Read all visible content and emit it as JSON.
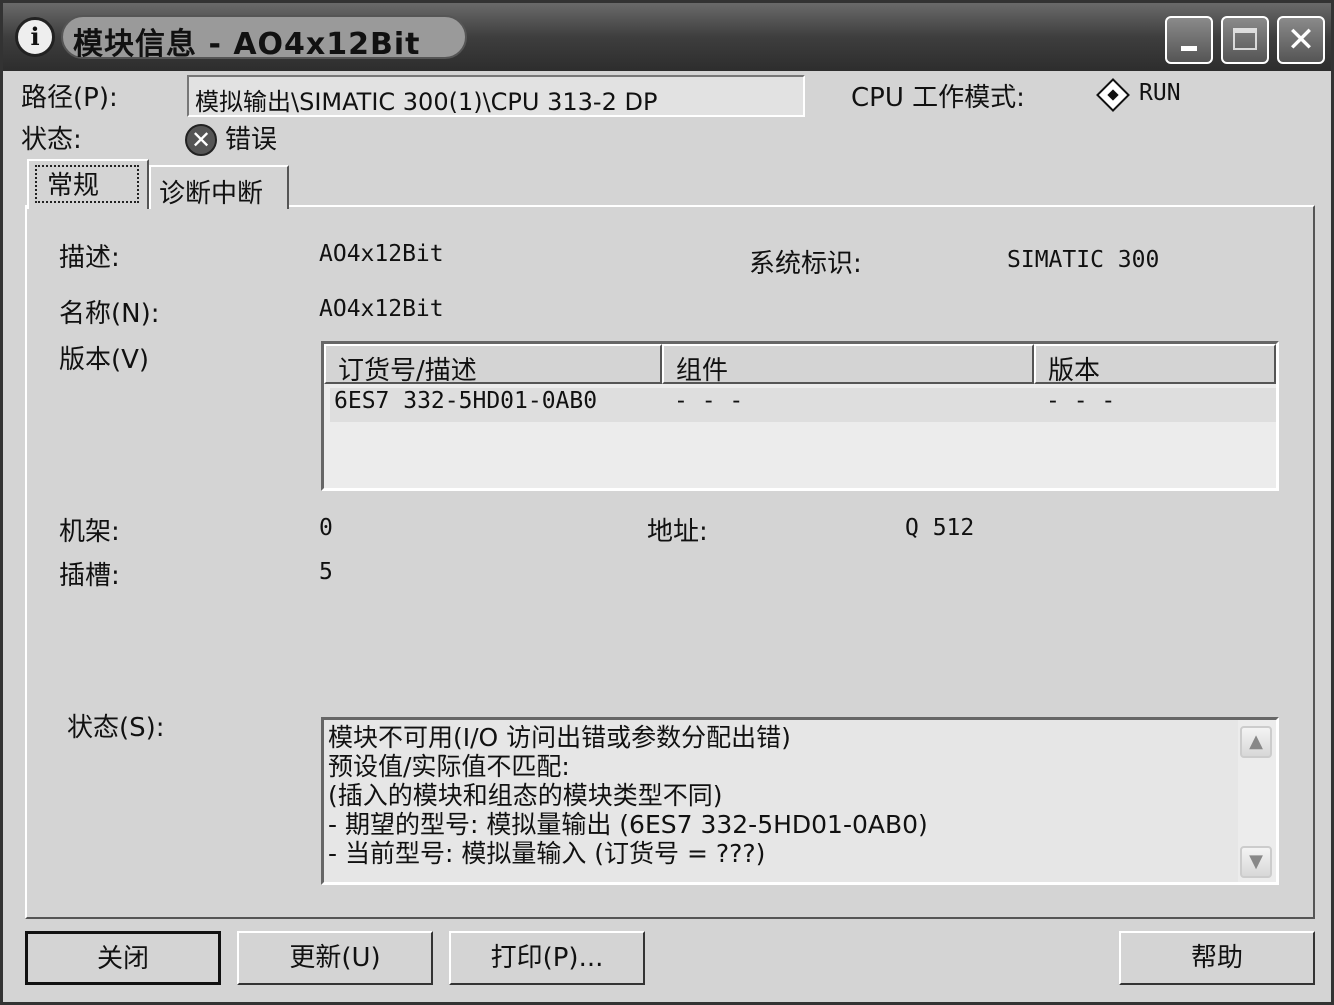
{
  "window": {
    "title": "模块信息 - AO4x12Bit",
    "icon_label": "i",
    "controls": {
      "minimize": "minimize-icon",
      "maximize": "maximize-icon",
      "close": "✕"
    }
  },
  "header": {
    "path_label": "路径(P):",
    "path_value": "模拟输出\\SIMATIC 300(1)\\CPU 313-2 DP",
    "cpu_mode_label": "CPU 工作模式:",
    "cpu_mode_value": "RUN",
    "status_label": "状态:",
    "status_value": "错误",
    "status_icon": "✕"
  },
  "tabs": [
    {
      "label": "常规"
    },
    {
      "label": "诊断中断"
    }
  ],
  "general": {
    "description_label": "描述:",
    "description_value": "AO4x12Bit",
    "system_id_label": "系统标识:",
    "system_id_value": "SIMATIC 300",
    "name_label": "名称(N):",
    "name_value": "AO4x12Bit",
    "version_label": "版本(V)",
    "version_table": {
      "columns": [
        "订货号/描述",
        "组件",
        "版本"
      ],
      "rows": [
        [
          "6ES7 332-5HD01-0AB0",
          "- - -",
          "- - -"
        ]
      ]
    },
    "rack_label": "机架:",
    "rack_value": "0",
    "address_label": "地址:",
    "address_value": "Q 512",
    "slot_label": "插槽:",
    "slot_value": "5",
    "status_label": "状态(S):",
    "status_lines": [
      "模块不可用(I/O 访问出错或参数分配出错)",
      "预设值/实际值不匹配:",
      "(插入的模块和组态的模块类型不同)",
      "- 期望的型号:    模拟量输出    (6ES7 332-5HD01-0AB0)",
      "- 当前型号:      模拟量输入 (订货号 = ???)"
    ],
    "scroll_up": "▲",
    "scroll_down": "▼"
  },
  "buttons": {
    "close": "关闭",
    "update": "更新(U)",
    "print": "打印(P)...",
    "help": "帮助"
  }
}
